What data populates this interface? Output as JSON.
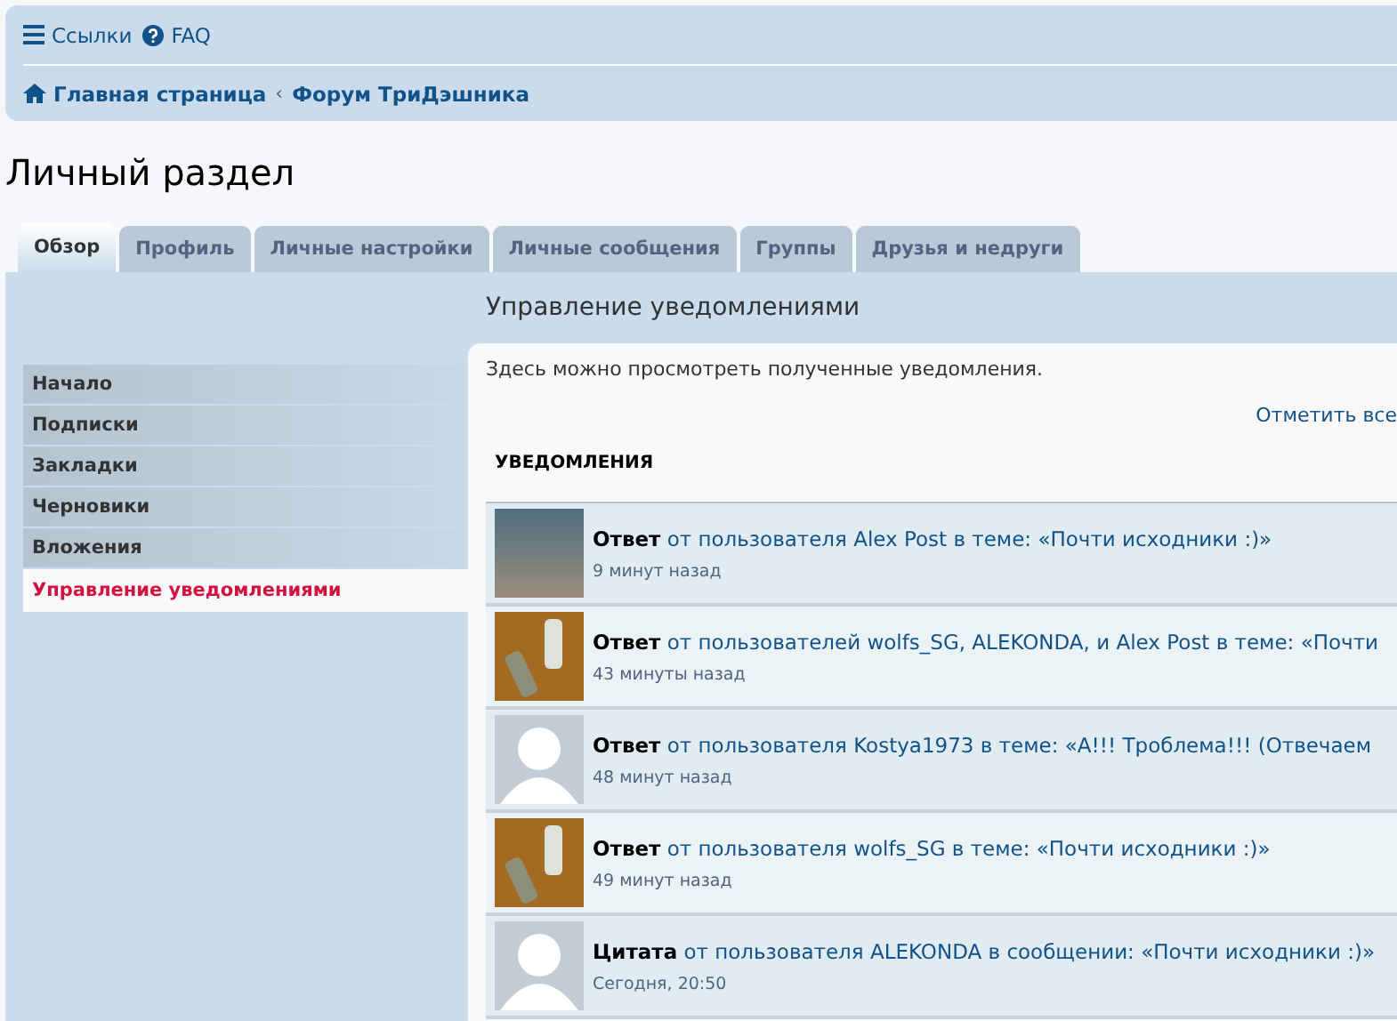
{
  "top_links": [
    {
      "kind": "menu",
      "label": "Ссылки"
    },
    {
      "kind": "help",
      "label": "FAQ"
    }
  ],
  "breadcrumbs": {
    "items": [
      "Главная страница",
      "Форум ТриДэшника"
    ],
    "separator": "‹"
  },
  "page_title": "Личный раздел",
  "tabs": [
    {
      "label": "Обзор",
      "selected": true
    },
    {
      "label": "Профиль",
      "selected": false
    },
    {
      "label": "Личные настройки",
      "selected": false
    },
    {
      "label": "Личные сообщения",
      "selected": false
    },
    {
      "label": "Группы",
      "selected": false
    },
    {
      "label": "Друзья и недруги",
      "selected": false
    }
  ],
  "sidebar": {
    "items": [
      {
        "label": "Начало",
        "selected": false
      },
      {
        "label": "Подписки",
        "selected": false
      },
      {
        "label": "Закладки",
        "selected": false
      },
      {
        "label": "Черновики",
        "selected": false
      },
      {
        "label": "Вложения",
        "selected": false
      },
      {
        "label": "Управление уведомлениями",
        "selected": true
      }
    ]
  },
  "content": {
    "title": "Управление уведомлениями",
    "description": "Здесь можно просмотреть полученные уведомления.",
    "mark_all": "Отметить все",
    "list_heading": "УВЕДОМЛЕНИЯ",
    "notifications": [
      {
        "kind": "photo",
        "type": "Ответ",
        "text": "от пользователя Alex Post в теме: «Почти исходники :)»",
        "time": "9 минут назад"
      },
      {
        "kind": "bottles",
        "type": "Ответ",
        "text": "от пользователей wolfs_SG, ALEKONDA, и Alex Post в теме: «Почти",
        "time": "43 минуты назад"
      },
      {
        "kind": "default",
        "type": "Ответ",
        "text": "от пользователя Kostya1973 в теме: «А!!! Троблема!!! (Отвечаем",
        "time": "48 минут назад"
      },
      {
        "kind": "bottles",
        "type": "Ответ",
        "text": "от пользователя wolfs_SG в теме: «Почти исходники :)»",
        "time": "49 минут назад"
      },
      {
        "kind": "default",
        "type": "Цитата",
        "text": "от пользователя ALEKONDA в сообщении: «Почти исходники :)»",
        "time": "Сегодня, 20:50"
      }
    ]
  }
}
